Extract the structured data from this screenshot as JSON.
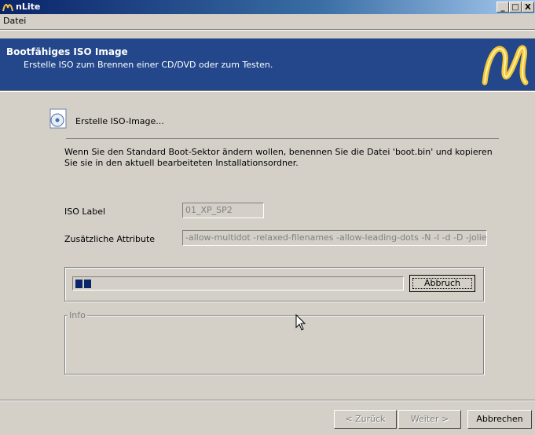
{
  "window": {
    "title": "nLite",
    "buttons": {
      "minimize": "_",
      "maximize": "□",
      "close": "X"
    }
  },
  "menu": {
    "items": [
      "Datei"
    ]
  },
  "header": {
    "title": "Bootfähiges ISO Image",
    "subtitle": "Erstelle ISO zum Brennen einer CD/DVD oder zum Testen."
  },
  "section": {
    "title": "Erstelle ISO-Image...",
    "description": "Wenn Sie den Standard Boot-Sektor ändern wollen, benennen Sie die Datei 'boot.bin' und kopieren Sie sie in den aktuell bearbeiteten Installationsordner."
  },
  "form": {
    "iso_label": {
      "label": "ISO Label",
      "value": "01_XP_SP2"
    },
    "attributes": {
      "label": "Zusätzliche Attribute",
      "value": "-allow-multidot -relaxed-filenames -allow-leading-dots -N -l -d -D -joliet-long -d"
    }
  },
  "progress": {
    "fraction": 0.04,
    "abort_label": "Abbruch"
  },
  "info": {
    "legend": "Info"
  },
  "footer": {
    "back_label": "< Zurück",
    "next_label": "Weiter >",
    "cancel_label": "Abbrechen"
  },
  "colors": {
    "title_start": "#0a246a",
    "header_bg": "#23478a",
    "progress_fill": "#0a246a"
  }
}
